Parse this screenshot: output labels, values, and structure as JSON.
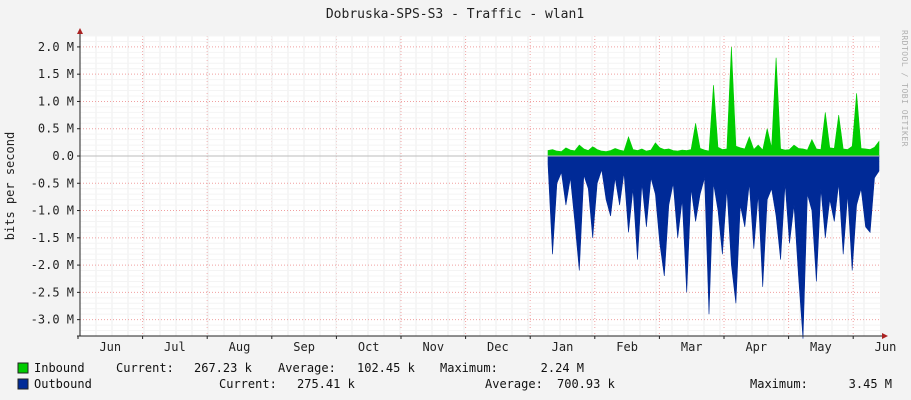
{
  "chart_data": {
    "type": "area",
    "title": "Dobruska-SPS-S3 - Traffic - wlan1",
    "ylabel": "bits per second",
    "xlabel": "",
    "watermark": "RRDTOOL / TOBI OETIKER",
    "ylim": [
      -3300000,
      2200000
    ],
    "yticks": [
      {
        "value": 2000000,
        "label": "2.0 M"
      },
      {
        "value": 1500000,
        "label": "1.5 M"
      },
      {
        "value": 1000000,
        "label": "1.0 M"
      },
      {
        "value": 500000,
        "label": "0.5 M"
      },
      {
        "value": 0,
        "label": "0.0"
      },
      {
        "value": -500000,
        "label": "-0.5 M"
      },
      {
        "value": -1000000,
        "label": "-1.0 M"
      },
      {
        "value": -1500000,
        "label": "-1.5 M"
      },
      {
        "value": -2000000,
        "label": "-2.0 M"
      },
      {
        "value": -2500000,
        "label": "-2.5 M"
      },
      {
        "value": -3000000,
        "label": "-3.0 M"
      }
    ],
    "x_categories": [
      "Jun",
      "Jul",
      "Aug",
      "Sep",
      "Oct",
      "Nov",
      "Dec",
      "Jan",
      "Feb",
      "Mar",
      "Apr",
      "May",
      "Jun"
    ],
    "grid": true,
    "legend_position": "bottom",
    "series": [
      {
        "name": "Inbound",
        "color": "#00cc00",
        "stats": {
          "current_label": "Current:",
          "current": "267.23 k",
          "average_label": "Average:",
          "average": "102.45 k",
          "maximum_label": "Maximum:",
          "maximum": "2.24 M"
        },
        "values": [
          100000,
          120000,
          90000,
          80000,
          150000,
          110000,
          95000,
          200000,
          130000,
          100000,
          170000,
          120000,
          90000,
          80000,
          100000,
          140000,
          110000,
          90000,
          350000,
          120000,
          100000,
          130000,
          90000,
          110000,
          240000,
          150000,
          120000,
          130000,
          100000,
          90000,
          110000,
          100000,
          120000,
          600000,
          140000,
          110000,
          90000,
          1300000,
          160000,
          120000,
          130000,
          2000000,
          180000,
          150000,
          130000,
          350000,
          120000,
          200000,
          110000,
          500000,
          150000,
          1800000,
          130000,
          110000,
          120000,
          200000,
          140000,
          130000,
          110000,
          300000,
          130000,
          120000,
          800000,
          150000,
          140000,
          750000,
          130000,
          120000,
          180000,
          1150000,
          140000,
          130000,
          120000,
          160000,
          267230
        ]
      },
      {
        "name": "Outbound",
        "color": "#002a97",
        "stats": {
          "current_label": "Current:",
          "current": "275.41 k",
          "average_label": "Average:",
          "average": "700.93 k",
          "maximum_label": "Maximum:",
          "maximum": "3.45 M"
        },
        "values": [
          -150000,
          -1800000,
          -500000,
          -300000,
          -900000,
          -400000,
          -1200000,
          -2100000,
          -350000,
          -600000,
          -1500000,
          -500000,
          -250000,
          -800000,
          -1100000,
          -400000,
          -900000,
          -300000,
          -1400000,
          -600000,
          -1900000,
          -500000,
          -1300000,
          -400000,
          -700000,
          -1600000,
          -2200000,
          -900000,
          -500000,
          -1500000,
          -800000,
          -2500000,
          -600000,
          -1200000,
          -700000,
          -400000,
          -2900000,
          -500000,
          -1000000,
          -1800000,
          -600000,
          -2000000,
          -2700000,
          -900000,
          -1300000,
          -500000,
          -1700000,
          -700000,
          -2400000,
          -800000,
          -600000,
          -1100000,
          -1900000,
          -500000,
          -1600000,
          -900000,
          -2200000,
          -3350000,
          -700000,
          -1000000,
          -2300000,
          -600000,
          -1500000,
          -800000,
          -1200000,
          -500000,
          -1800000,
          -700000,
          -2100000,
          -900000,
          -600000,
          -1300000,
          -1400000,
          -400000,
          -275410
        ]
      }
    ]
  }
}
